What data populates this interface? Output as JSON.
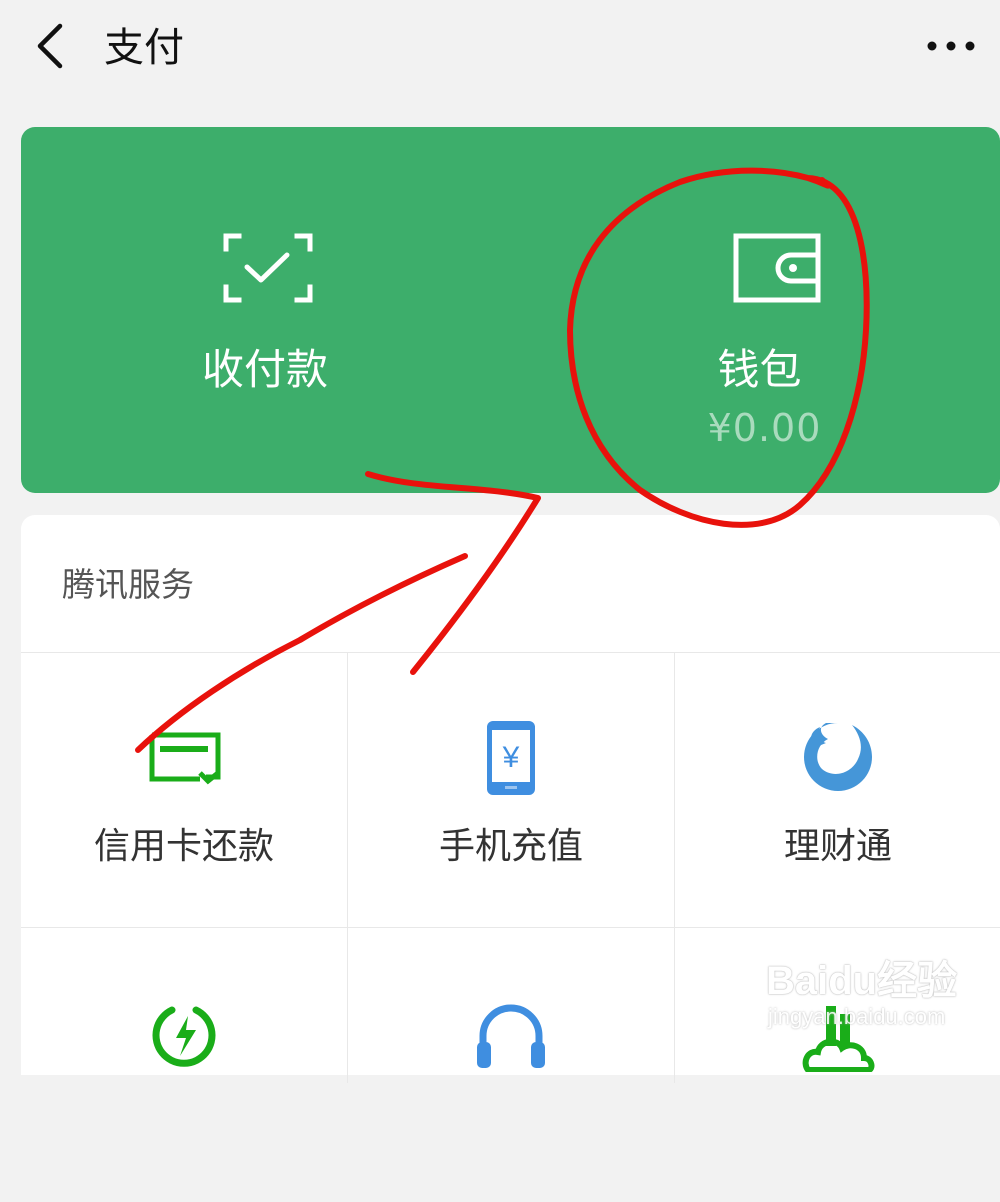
{
  "header": {
    "title": "支付",
    "back_icon": "chevron-left-icon",
    "more_icon": "ellipsis-icon"
  },
  "wallet_card": {
    "background_color": "#3dae6b",
    "pay": {
      "label": "收付款",
      "icon": "scan-check-icon"
    },
    "wallet": {
      "label": "钱包",
      "balance": "¥0.00",
      "icon": "wallet-icon"
    }
  },
  "services": {
    "section_title": "腾讯服务",
    "items": [
      {
        "label": "信用卡还款",
        "icon": "credit-card-icon",
        "color": "#1aad19"
      },
      {
        "label": "手机充值",
        "icon": "phone-recharge-icon",
        "color": "#3f8ee0"
      },
      {
        "label": "理财通",
        "icon": "licaitong-fish-icon",
        "color": "#4596d8"
      },
      {
        "label": "",
        "icon": "lightning-icon",
        "color": "#1aad19"
      },
      {
        "label": "",
        "icon": "headset-icon",
        "color": "#3f8ee0"
      },
      {
        "label": "",
        "icon": "city-cloud-icon",
        "color": "#1aad19"
      }
    ]
  },
  "annotation": {
    "color": "#e8120c",
    "marks": [
      "circle-around-wallet",
      "arrow-to-wallet"
    ]
  },
  "watermark": {
    "brand": "Baidu经验",
    "url": "jingyan.baidu.com"
  }
}
